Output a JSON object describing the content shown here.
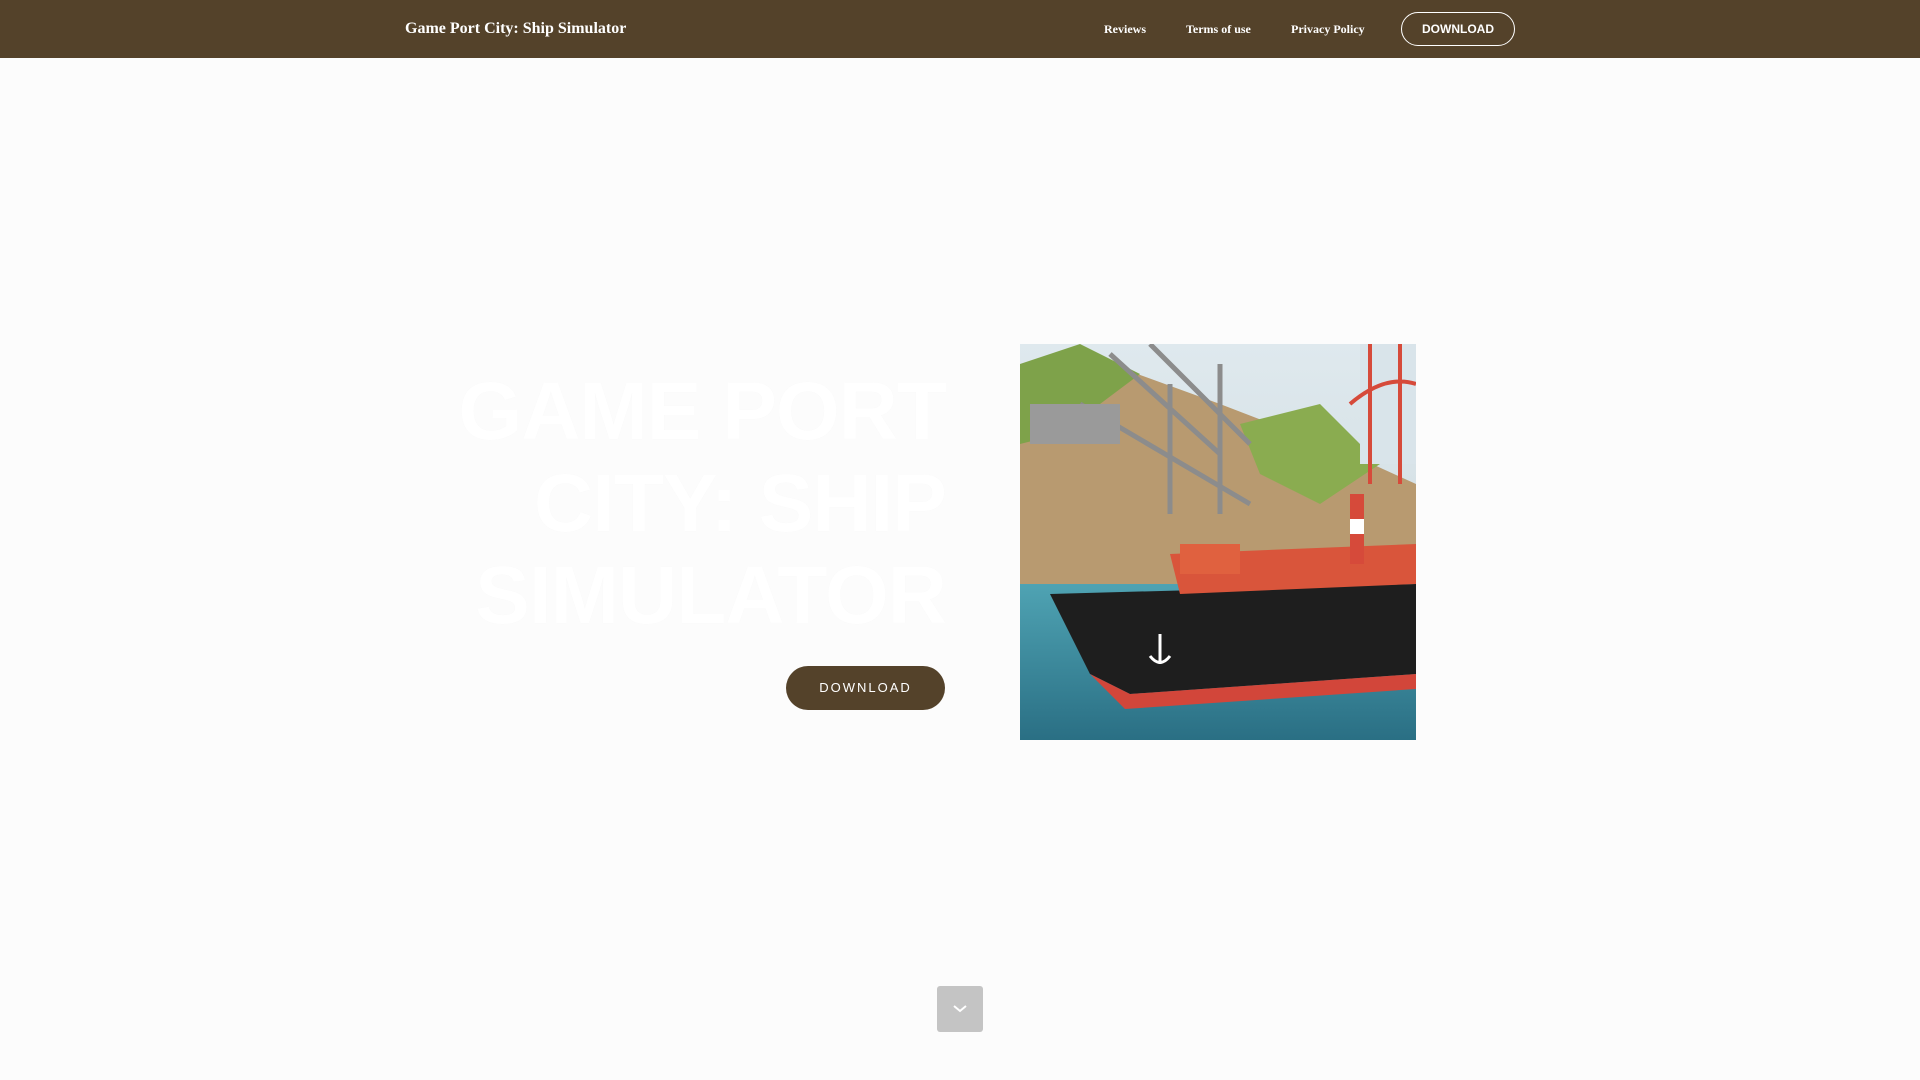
{
  "header": {
    "brand": "Game Port City: Ship Simulator",
    "nav": [
      {
        "label": "Reviews"
      },
      {
        "label": "Terms of use"
      },
      {
        "label": "Privacy Policy"
      }
    ],
    "download_label": "DOWNLOAD"
  },
  "hero": {
    "title": "GAME PORT CITY: SHIP SIMULATOR",
    "download_label": "DOWNLOAD"
  },
  "icons": {
    "scroll": "chevron-down-icon"
  },
  "colors": {
    "brand": "#54422a",
    "background": "#fcfcfc",
    "scroll_button": "#c4c4c4"
  }
}
